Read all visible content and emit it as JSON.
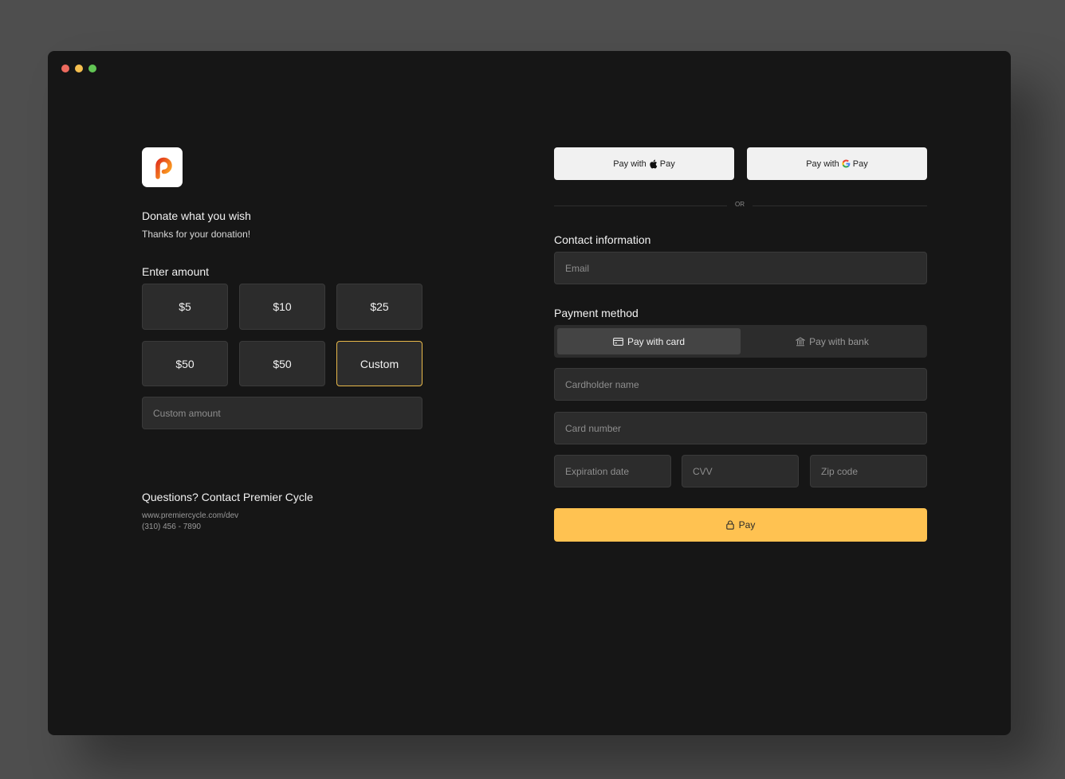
{
  "donation": {
    "title": "Donate what you wish",
    "subtitle": "Thanks for your donation!",
    "amount_label": "Enter amount",
    "amounts": [
      {
        "label": "$5",
        "selected": false
      },
      {
        "label": "$10",
        "selected": false
      },
      {
        "label": "$25",
        "selected": false
      },
      {
        "label": "$50",
        "selected": false
      },
      {
        "label": "$50",
        "selected": false
      },
      {
        "label": "Custom",
        "selected": true
      }
    ],
    "custom_placeholder": "Custom amount",
    "questions": "Questions? Contact Premier Cycle",
    "website": "www.premiercycle.com/dev",
    "phone": "(310) 456 - 7890"
  },
  "wallets": {
    "apple_prefix": "Pay with",
    "apple_suffix": "Pay",
    "google_prefix": "Pay with",
    "google_suffix": "Pay",
    "divider": "OR"
  },
  "contact": {
    "label": "Contact information",
    "email_placeholder": "Email"
  },
  "payment": {
    "label": "Payment method",
    "tabs": [
      {
        "label": "Pay with card",
        "icon": "credit-card-icon",
        "active": true
      },
      {
        "label": "Pay with bank",
        "icon": "bank-icon",
        "active": false
      }
    ],
    "cardholder_placeholder": "Cardholder name",
    "card_number_placeholder": "Card number",
    "expiration_placeholder": "Expiration date",
    "cvv_placeholder": "CVV",
    "zip_placeholder": "Zip code",
    "pay_label": "Pay"
  },
  "colors": {
    "accent": "#ffc251",
    "selected_border": "#e8b84a",
    "background": "#161616",
    "surface": "#2c2c2c"
  }
}
